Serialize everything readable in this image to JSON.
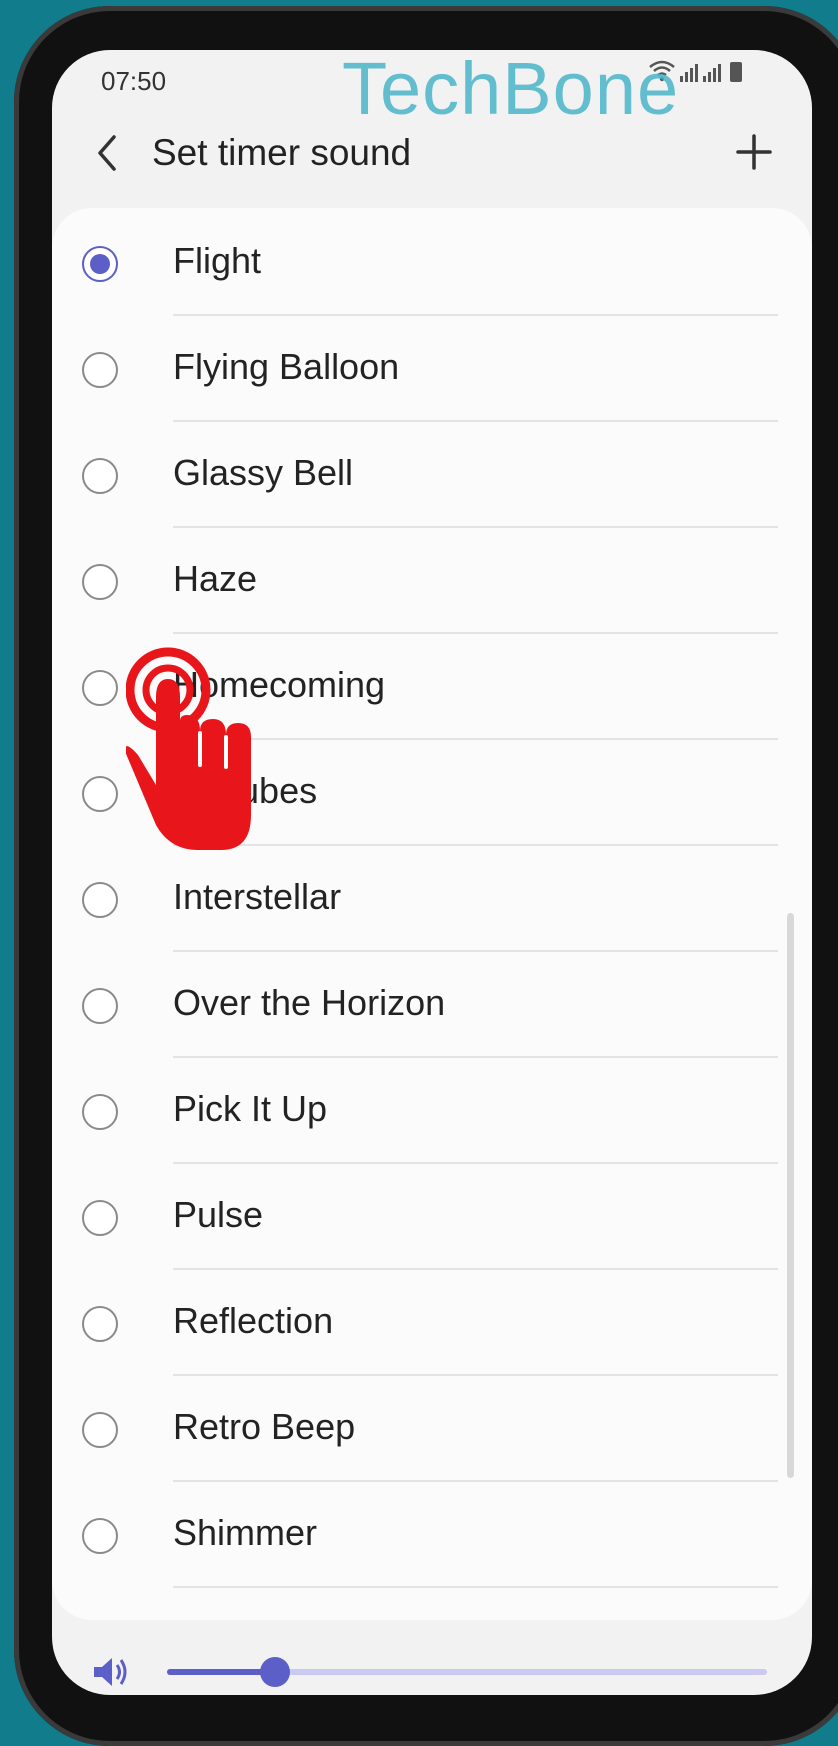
{
  "status_bar": {
    "time": "07:50"
  },
  "watermark": "TechBone",
  "header": {
    "title": "Set timer sound"
  },
  "sounds": [
    {
      "label": "Flight",
      "selected": true
    },
    {
      "label": "Flying Balloon",
      "selected": false
    },
    {
      "label": "Glassy Bell",
      "selected": false
    },
    {
      "label": "Haze",
      "selected": false
    },
    {
      "label": "Homecoming",
      "selected": false
    },
    {
      "label": "Icecubes",
      "selected": false
    },
    {
      "label": "Interstellar",
      "selected": false
    },
    {
      "label": "Over the Horizon",
      "selected": false
    },
    {
      "label": "Pick It Up",
      "selected": false
    },
    {
      "label": "Pulse",
      "selected": false
    },
    {
      "label": "Reflection",
      "selected": false
    },
    {
      "label": "Retro Beep",
      "selected": false
    },
    {
      "label": "Shimmer",
      "selected": false
    }
  ],
  "volume": {
    "level_fraction": 0.18
  },
  "colors": {
    "accent": "#5b5fc7",
    "tap_hint": "#e8161b",
    "watermark": "#49b6c8"
  },
  "icons": {
    "back": "chevron-left-icon",
    "add": "plus-icon",
    "volume": "speaker-icon",
    "tap_hint": "tap-hand-icon"
  }
}
